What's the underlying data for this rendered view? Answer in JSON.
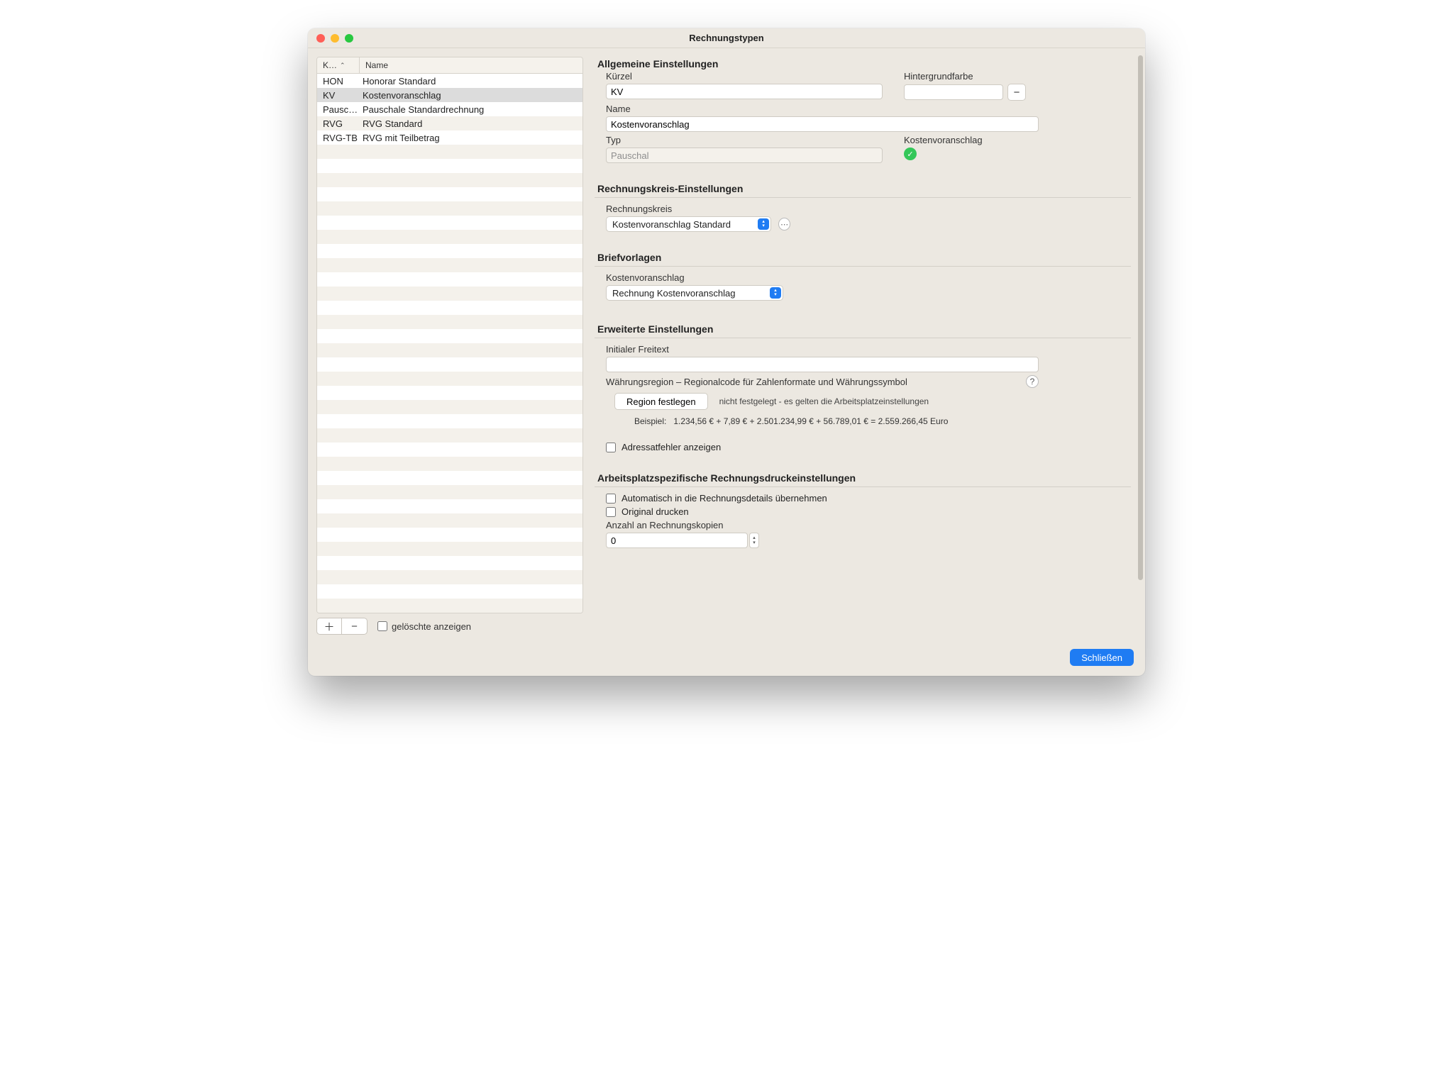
{
  "window": {
    "title": "Rechnungstypen"
  },
  "sidebar": {
    "columns": {
      "kurz": "K…",
      "name": "Name"
    },
    "rows": [
      {
        "k": "HON",
        "name": "Honorar Standard",
        "selected": false
      },
      {
        "k": "KV",
        "name": "Kostenvoranschlag",
        "selected": true
      },
      {
        "k": "Pausc…",
        "name": "Pauschale Standardrechnung",
        "selected": false
      },
      {
        "k": "RVG",
        "name": "RVG Standard",
        "selected": false
      },
      {
        "k": "RVG-TB",
        "name": "RVG mit Teilbetrag",
        "selected": false
      }
    ],
    "show_deleted_label": "gelöschte anzeigen"
  },
  "general": {
    "heading": "Allgemeine Einstellungen",
    "kuerzel_label": "Kürzel",
    "kuerzel_value": "KV",
    "bgcolor_label": "Hintergrundfarbe",
    "name_label": "Name",
    "name_value": "Kostenvoranschlag",
    "typ_label": "Typ",
    "typ_value": "Pauschal",
    "kv_label": "Kostenvoranschlag"
  },
  "kreis": {
    "heading": "Rechnungskreis-Einstellungen",
    "label": "Rechnungskreis",
    "value": "Kostenvoranschlag Standard"
  },
  "brief": {
    "heading": "Briefvorlagen",
    "label": "Kostenvoranschlag",
    "value": "Rechnung Kostenvoranschlag"
  },
  "advanced": {
    "heading": "Erweiterte Einstellungen",
    "freetext_label": "Initialer Freitext",
    "freetext_value": "",
    "region_label": "Währungsregion – Regionalcode für Zahlenformate und Währungssymbol",
    "region_button": "Region festlegen",
    "region_hint": "nicht festgelegt - es gelten die Arbeitsplatzeinstellungen",
    "example_label": "Beispiel:",
    "example_value": "1.234,56 € + 7,89 € + 2.501.234,99 € + 56.789,01 € = 2.559.266,45 Euro",
    "show_addr_errors": "Adressatfehler anzeigen"
  },
  "print": {
    "heading": "Arbeitsplatzspezifische Rechnungsdruckeinstellungen",
    "auto_label": "Automatisch in die Rechnungsdetails übernehmen",
    "original_label": "Original drucken",
    "copies_label": "Anzahl an Rechnungskopien",
    "copies_value": "0"
  },
  "footer": {
    "close": "Schließen"
  }
}
